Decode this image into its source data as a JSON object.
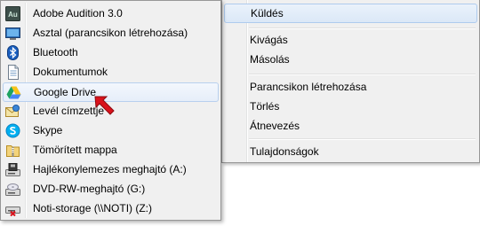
{
  "context_menu": {
    "items": [
      {
        "label": "Küldés"
      },
      {
        "label": "Kivágás"
      },
      {
        "label": "Másolás"
      },
      {
        "label": "Parancsikon létrehozása"
      },
      {
        "label": "Törlés"
      },
      {
        "label": "Átnevezés"
      },
      {
        "label": "Tulajdonságok"
      }
    ]
  },
  "send_to_menu": {
    "items": [
      {
        "label": "Adobe Audition 3.0",
        "icon": "adobe-audition-icon"
      },
      {
        "label": "Asztal (parancsikon létrehozása)",
        "icon": "desktop-icon"
      },
      {
        "label": "Bluetooth",
        "icon": "bluetooth-icon"
      },
      {
        "label": "Dokumentumok",
        "icon": "documents-icon"
      },
      {
        "label": "Google Drive",
        "icon": "google-drive-icon"
      },
      {
        "label": "Levél címzettje",
        "icon": "mail-recipient-icon"
      },
      {
        "label": "Skype",
        "icon": "skype-icon"
      },
      {
        "label": "Tömörített mappa",
        "icon": "zip-folder-icon"
      },
      {
        "label": "Hajlékonylemezes meghajtó (A:)",
        "icon": "floppy-drive-icon"
      },
      {
        "label": "DVD-RW-meghajtó (G:)",
        "icon": "dvd-drive-icon"
      },
      {
        "label": "Noti-storage (\\\\NOTI) (Z:)",
        "icon": "network-drive-icon"
      }
    ]
  },
  "icon_texts": {
    "audition": "Au"
  },
  "colors": {
    "pointer_arrow": "#d9121b",
    "highlight_border": "#aecbee"
  }
}
